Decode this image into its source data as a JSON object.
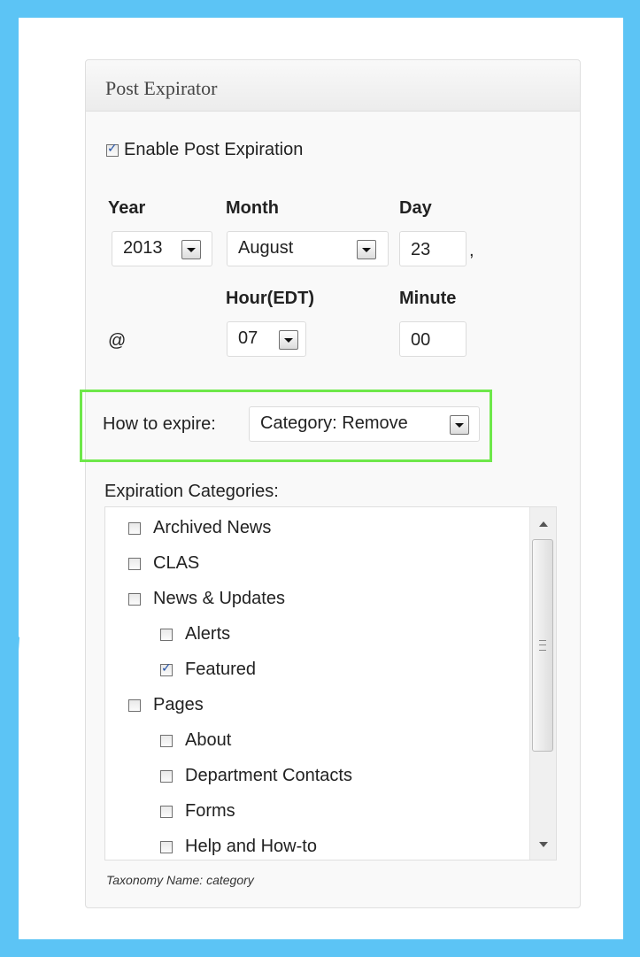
{
  "panel": {
    "title": "Post Expirator",
    "enable_label": "Enable Post Expiration",
    "enable_checked": true
  },
  "date": {
    "year_label": "Year",
    "month_label": "Month",
    "day_label": "Day",
    "year_value": "2013",
    "month_value": "August",
    "day_value": "23",
    "comma": ","
  },
  "time": {
    "at_symbol": "@",
    "hour_label": "Hour(EDT)",
    "minute_label": "Minute",
    "hour_value": "07",
    "minute_value": "00"
  },
  "expire": {
    "label": "How to expire:",
    "value": "Category: Remove"
  },
  "categories": {
    "label": "Expiration Categories:",
    "items": [
      {
        "label": "Archived News",
        "checked": false
      },
      {
        "label": "CLAS",
        "checked": false
      },
      {
        "label": "News & Updates",
        "checked": false
      },
      {
        "label": "Alerts",
        "checked": false
      },
      {
        "label": "Featured",
        "checked": true
      },
      {
        "label": "Pages",
        "checked": false
      },
      {
        "label": "About",
        "checked": false
      },
      {
        "label": "Department Contacts",
        "checked": false
      },
      {
        "label": "Forms",
        "checked": false
      },
      {
        "label": "Help and How-to",
        "checked": false
      }
    ],
    "taxonomy_note": "Taxonomy Name: category"
  },
  "colors": {
    "frame": "#5cc4f5",
    "highlight": "#6ee84a"
  }
}
